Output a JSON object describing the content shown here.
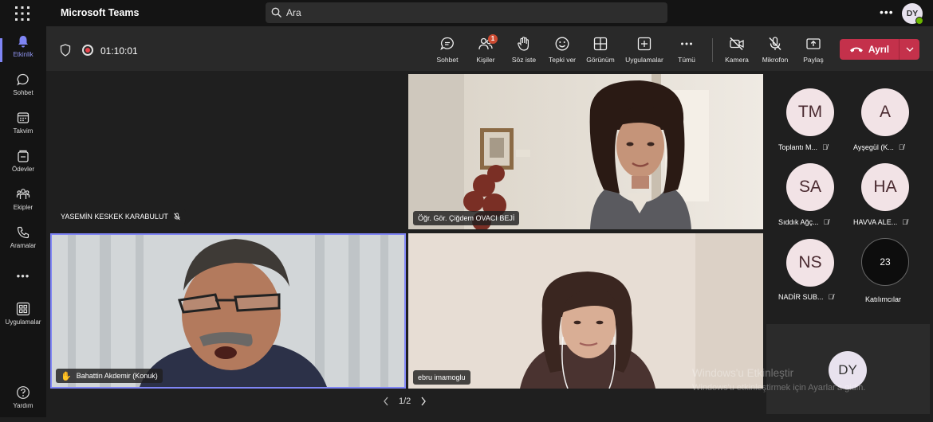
{
  "app": {
    "title": "Microsoft Teams"
  },
  "search": {
    "placeholder": "Ara"
  },
  "user": {
    "initials": "DY"
  },
  "rail": [
    {
      "label": "Etkinlik",
      "icon": "bell-icon",
      "active": true
    },
    {
      "label": "Sohbet",
      "icon": "chat-icon"
    },
    {
      "label": "Takvim",
      "icon": "calendar-icon"
    },
    {
      "label": "Ödevler",
      "icon": "assignments-icon"
    },
    {
      "label": "Ekipler",
      "icon": "teams-icon"
    },
    {
      "label": "Aramalar",
      "icon": "phone-icon"
    },
    {
      "label": "Uygulamalar",
      "icon": "apps-icon"
    },
    {
      "label": "Yardım",
      "icon": "help-icon"
    }
  ],
  "call": {
    "timer": "01:10:01",
    "controls": [
      {
        "label": "Sohbet",
        "icon": "chat-icon"
      },
      {
        "label": "Kişiler",
        "icon": "people-icon",
        "badge": "1"
      },
      {
        "label": "Söz iste",
        "icon": "raise-hand-icon"
      },
      {
        "label": "Tepki ver",
        "icon": "emoji-icon"
      },
      {
        "label": "Görünüm",
        "icon": "layout-icon"
      },
      {
        "label": "Uygulamalar",
        "icon": "add-apps-icon"
      },
      {
        "label": "Tümü",
        "icon": "more-icon"
      },
      {
        "label": "Kamera",
        "icon": "camera-off-icon"
      },
      {
        "label": "Mikrofon",
        "icon": "mic-off-icon"
      },
      {
        "label": "Paylaş",
        "icon": "share-icon"
      }
    ],
    "leave_label": "Ayrıl"
  },
  "tiles": [
    {
      "name": "YASEMİN KESKEK KARABULUT",
      "muted": true,
      "video": false
    },
    {
      "name": "Öğr. Gör. Çiğdem OVACI BEJİ",
      "muted": false,
      "video": true
    },
    {
      "name": "Bahattin Akdemir (Konuk)",
      "muted": false,
      "video": true,
      "hand_raised": true,
      "speaking": true
    },
    {
      "name": "ebru imamoglu",
      "muted": false,
      "video": true
    }
  ],
  "gallery": [
    {
      "initials": "TM",
      "name": "Toplantı M...",
      "muted": true
    },
    {
      "initials": "A",
      "name": "Ayşegül (K...",
      "muted": true
    },
    {
      "initials": "SA",
      "name": "Sıddık Ağç...",
      "muted": true
    },
    {
      "initials": "HA",
      "name": "HAVVA ALE...",
      "muted": true
    },
    {
      "initials": "NS",
      "name": "NADİR SUB...",
      "muted": true
    }
  ],
  "more_participants": {
    "count": "23",
    "label": "Katılımcılar"
  },
  "self_view": {
    "initials": "DY"
  },
  "pager": {
    "text": "1/2"
  },
  "watermark": {
    "line1": "Windows'u Etkinleştir",
    "line2": "Windows'u etkinleştirmek için Ayarlar'a gidin."
  }
}
